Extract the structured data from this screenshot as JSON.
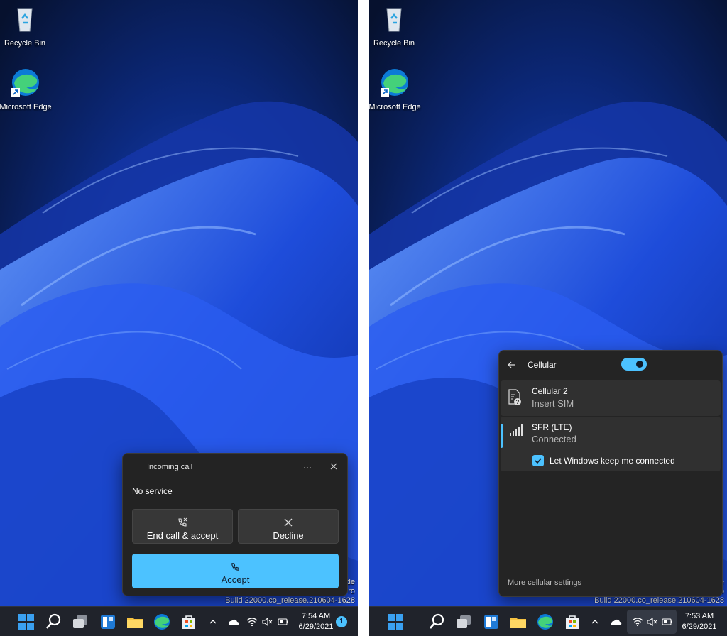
{
  "desktop": {
    "icons": [
      {
        "label": "Recycle Bin"
      },
      {
        "label": "Microsoft Edge"
      }
    ],
    "build_text": "Build 22000.co_release.210604-1628",
    "watermark_fragments": [
      "de",
      "Pro"
    ]
  },
  "left": {
    "call": {
      "title": "Incoming call",
      "more_label": "···",
      "status": "No service",
      "end_accept_label": "End call & accept",
      "decline_label": "Decline",
      "accept_label": "Accept"
    },
    "clock": {
      "time": "7:54 AM",
      "date": "6/29/2021"
    },
    "badge": "1"
  },
  "right": {
    "cellular": {
      "title": "Cellular",
      "toggle_on": true,
      "items": [
        {
          "name": "Cellular 2",
          "status": "Insert SIM"
        },
        {
          "name": "SFR (LTE)",
          "status": "Connected"
        }
      ],
      "checkbox_label": "Let Windows keep me connected",
      "checkbox_checked": true,
      "more_settings": "More cellular settings"
    },
    "clock": {
      "time": "7:53 AM",
      "date": "6/29/2021"
    }
  },
  "colors": {
    "accent": "#4cc2ff",
    "panel": "#2b2b2b",
    "taskbar": "#20232b"
  }
}
